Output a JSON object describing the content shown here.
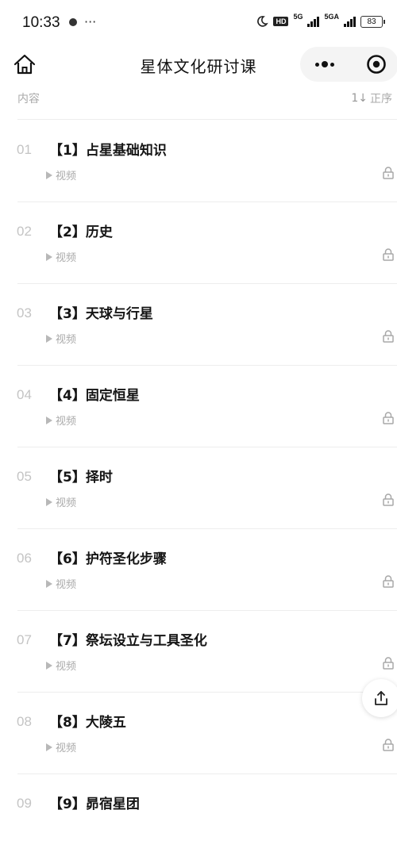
{
  "status_bar": {
    "time": "10:33",
    "extra": "···",
    "network_1": "5G",
    "network_2": "5GA",
    "battery": "83"
  },
  "nav": {
    "title": "星体文化研讨课",
    "home_icon": "home-icon",
    "more_icon": "more-dots-icon",
    "close_icon": "target-close-icon"
  },
  "list_header": {
    "left_label": "内容",
    "right_label": "正序",
    "sort_icon_text": "1↓"
  },
  "lessons": [
    {
      "num": "01",
      "title": "【1】占星基础知识",
      "type": "视频"
    },
    {
      "num": "02",
      "title": "【2】历史",
      "type": "视频"
    },
    {
      "num": "03",
      "title": "【3】天球与行星",
      "type": "视频"
    },
    {
      "num": "04",
      "title": "【4】固定恒星",
      "type": "视频"
    },
    {
      "num": "05",
      "title": "【5】择时",
      "type": "视频"
    },
    {
      "num": "06",
      "title": "【6】护符圣化步骤",
      "type": "视频"
    },
    {
      "num": "07",
      "title": "【7】祭坛设立与工具圣化",
      "type": "视频"
    },
    {
      "num": "08",
      "title": "【8】大陵五",
      "type": "视频"
    },
    {
      "num": "09",
      "title": "【9】昴宿星团",
      "type": ""
    }
  ],
  "colors": {
    "title": "#111111",
    "muted": "#aaaaaa",
    "number": "#c4c4c4",
    "divider": "#ededed"
  }
}
